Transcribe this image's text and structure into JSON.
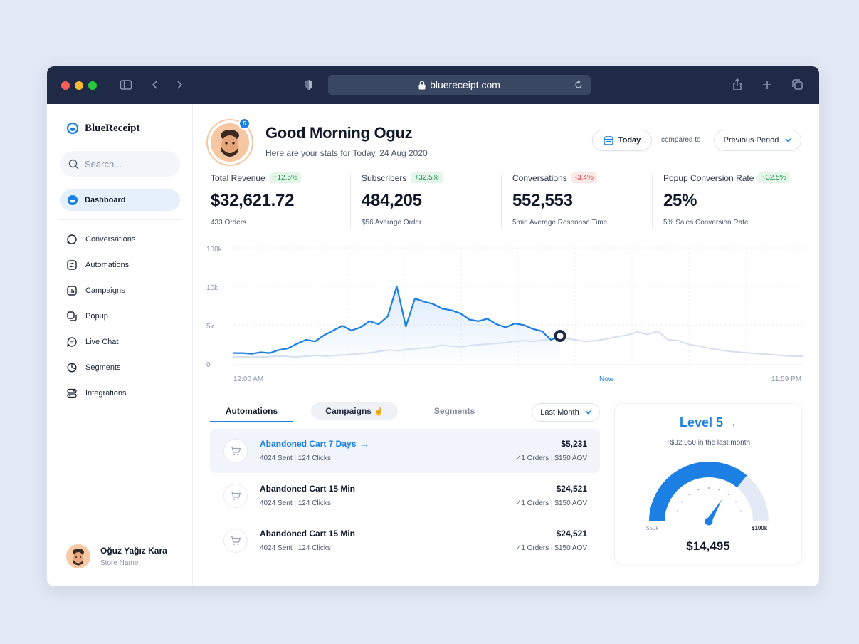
{
  "browser": {
    "url": "bluereceipt.com"
  },
  "app": {
    "name": "BlueReceipt"
  },
  "sidebar": {
    "search_placeholder": "Search...",
    "active_item": "Dashboard",
    "items": [
      "Conversations",
      "Automations",
      "Campaigns",
      "Popup",
      "Live Chat",
      "Segments",
      "Integrations"
    ],
    "user": {
      "name": "Oğuz Yağız Kara",
      "store": "Store Name"
    }
  },
  "header": {
    "notification_count": "5",
    "greeting": "Good Morning Oguz",
    "subtitle": "Here are your stats for Today, 24 Aug 2020",
    "today_label": "Today",
    "compared_label": "compared to",
    "period_label": "Previous Period"
  },
  "stats": [
    {
      "label": "Total Revenue",
      "change": "+12.5%",
      "trend": "up",
      "value": "$32,621.72",
      "sub": "433 Orders"
    },
    {
      "label": "Subscribers",
      "change": "+32.5%",
      "trend": "up",
      "value": "484,205",
      "sub": "$56 Average Order"
    },
    {
      "label": "Conversations",
      "change": "-3.4%",
      "trend": "down",
      "value": "552,553",
      "sub": "5min Average Response Time"
    },
    {
      "label": "Popup Conversion Rate",
      "change": "+32.5%",
      "trend": "up",
      "value": "25%",
      "sub": "5% Sales Conversion Rate"
    }
  ],
  "chart_data": {
    "type": "line",
    "y_tick_labels": [
      "100k",
      "10k",
      "5k",
      "0"
    ],
    "x_tick_labels": [
      "12:00 AM",
      "Now",
      "11:59 PM"
    ],
    "colors": {
      "current": "#1b7fe3",
      "previous": "#d6dff0"
    },
    "series": [
      {
        "values": [
          1500,
          1500,
          1400,
          1600,
          1500,
          1900,
          2100,
          2700,
          3200,
          3000,
          3800,
          4400,
          5000,
          4400,
          4800,
          5600,
          5200,
          6200,
          11000,
          4900,
          8500,
          8100,
          7800,
          7200,
          7000,
          6600,
          5800,
          5600,
          5900,
          5200,
          4800,
          5300,
          5100,
          4600,
          4300,
          3200,
          3700
        ]
      },
      {
        "values": [
          1000,
          1000,
          1000,
          1000,
          1100,
          1100,
          1000,
          1100,
          1200,
          1100,
          1200,
          1300,
          1400,
          1500,
          1700,
          1900,
          1800,
          2000,
          2100,
          2200,
          2500,
          2400,
          2300,
          2500,
          2600,
          2700,
          2800,
          3000,
          3100,
          3000,
          3200,
          3300,
          3400,
          3200,
          3000,
          3100,
          3300,
          3600,
          3800,
          4200,
          3900,
          4300,
          3200,
          3100,
          2600,
          2400,
          2100,
          1900,
          1700,
          1600,
          1500,
          1400,
          1300,
          1200,
          1100,
          1100
        ]
      }
    ]
  },
  "tabs": [
    "Automations",
    "Campaigns",
    "Segments"
  ],
  "filter": {
    "label": "Last Month"
  },
  "rows": [
    {
      "title": "Abandoned Cart 7 Days",
      "meta": "4024 Sent | 124 Clicks",
      "amount": "$5,231",
      "orders": "41 Orders | $150 AOV"
    },
    {
      "title": "Abandoned Cart 15 Min",
      "meta": "4024 Sent | 124 Clicks",
      "amount": "$24,521",
      "orders": "41 Orders | $150 AOV"
    },
    {
      "title": "Abandoned Cart 15 Min",
      "meta": "4024 Sent | 124 Clicks",
      "amount": "$24,521",
      "orders": "41 Orders | $150 AOV"
    }
  ],
  "level": {
    "title": "Level 5",
    "subtitle": "+$32,050 in the last month",
    "min_label": "$50k",
    "max_label": "$100k",
    "value": "$14,495",
    "progress": 0.72
  },
  "colors": {
    "accent": "#1b7fe3",
    "titlebar": "#1e2a46"
  }
}
